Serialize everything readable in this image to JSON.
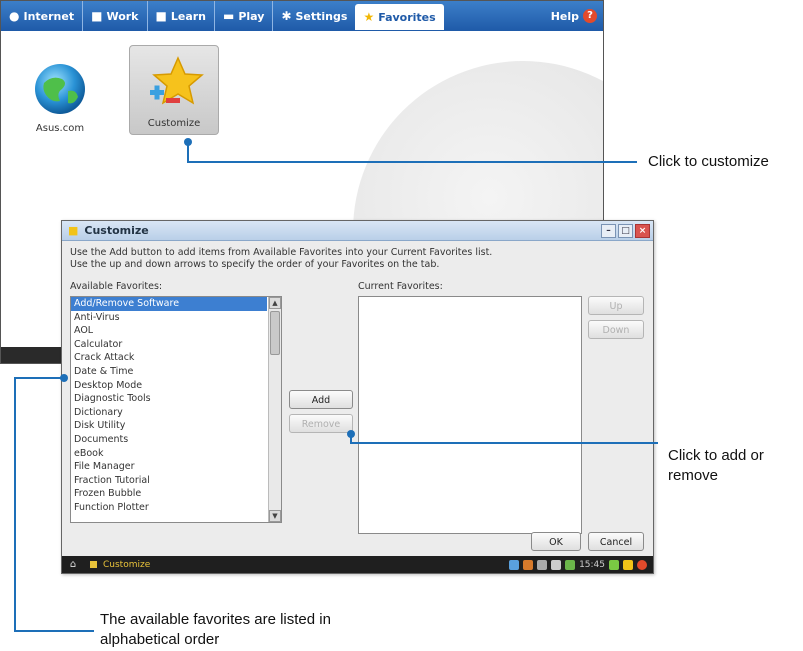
{
  "launcher": {
    "tabs": [
      {
        "label": "Internet",
        "icon": "globe-icon"
      },
      {
        "label": "Work",
        "icon": "briefcase-icon"
      },
      {
        "label": "Learn",
        "icon": "book-icon"
      },
      {
        "label": "Play",
        "icon": "gamepad-icon"
      },
      {
        "label": "Settings",
        "icon": "settings-icon"
      },
      {
        "label": "Favorites",
        "icon": "star-icon"
      }
    ],
    "help_label": "Help",
    "apps": [
      {
        "label": "Asus.com",
        "icon": "globe-icon"
      },
      {
        "label": "Customize",
        "icon": "star-icon"
      }
    ]
  },
  "dialog": {
    "title": "Customize",
    "instruction_line1": "Use the Add button to add items from Available Favorites into your Current Favorites list.",
    "instruction_line2": "Use the up and down arrows to specify the order of your Favorites on the tab.",
    "available_label": "Available Favorites:",
    "current_label": "Current Favorites:",
    "available_items": [
      "Add/Remove Software",
      "Anti-Virus",
      "AOL",
      "Calculator",
      "Crack Attack",
      "Date & Time",
      "Desktop Mode",
      "Diagnostic Tools",
      "Dictionary",
      "Disk Utility",
      "Documents",
      "eBook",
      "File Manager",
      "Fraction Tutorial",
      "Frozen Bubble",
      "Function Plotter"
    ],
    "selected_item": "Add/Remove Software",
    "add_label": "Add",
    "remove_label": "Remove",
    "up_label": "Up",
    "down_label": "Down",
    "ok_label": "OK",
    "cancel_label": "Cancel",
    "taskbar_item": "Customize",
    "clock": "15:45"
  },
  "callouts": {
    "customize": "Click to customize",
    "add_remove_line1": "Click to add or",
    "add_remove_line2": "remove",
    "alpha_line1": "The available favorites are listed in",
    "alpha_line2": "alphabetical order"
  },
  "colors": {
    "accent": "#1d6fb8",
    "tabbar": "#1f5aa8",
    "selection": "#3d7fd1"
  }
}
